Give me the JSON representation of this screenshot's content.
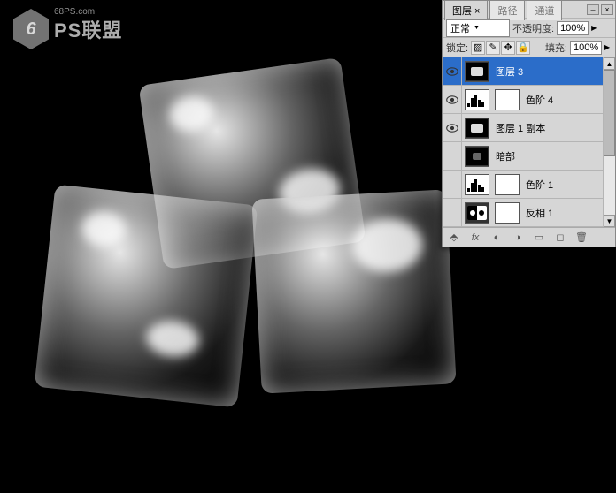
{
  "watermark": {
    "url": "68PS.com",
    "brand": "PS联盟"
  },
  "panel": {
    "tabs": {
      "layers": "图层",
      "paths": "路径",
      "channels": "通道"
    },
    "titlebar": {
      "minimize": "–",
      "close": "×"
    },
    "blend": {
      "mode": "正常",
      "opacity_label": "不透明度:",
      "opacity": "100%",
      "fill_label": "填充:",
      "fill": "100%",
      "lock_label": "锁定:"
    },
    "layers": [
      {
        "name": "图层 3",
        "type": "image",
        "visible": true,
        "selected": true
      },
      {
        "name": "色阶 4",
        "type": "levels",
        "visible": true,
        "selected": false,
        "mask": true
      },
      {
        "name": "图层 1 副本",
        "type": "image",
        "visible": true,
        "selected": false
      },
      {
        "name": "暗部",
        "type": "dark",
        "visible": false,
        "selected": false
      },
      {
        "name": "色阶 1",
        "type": "levels",
        "visible": false,
        "selected": false,
        "mask": true
      },
      {
        "name": "反相 1",
        "type": "invert",
        "visible": false,
        "selected": false,
        "mask": true
      }
    ],
    "footer_icons": [
      "link",
      "fx",
      "mask",
      "adjust",
      "group",
      "new",
      "trash"
    ]
  }
}
